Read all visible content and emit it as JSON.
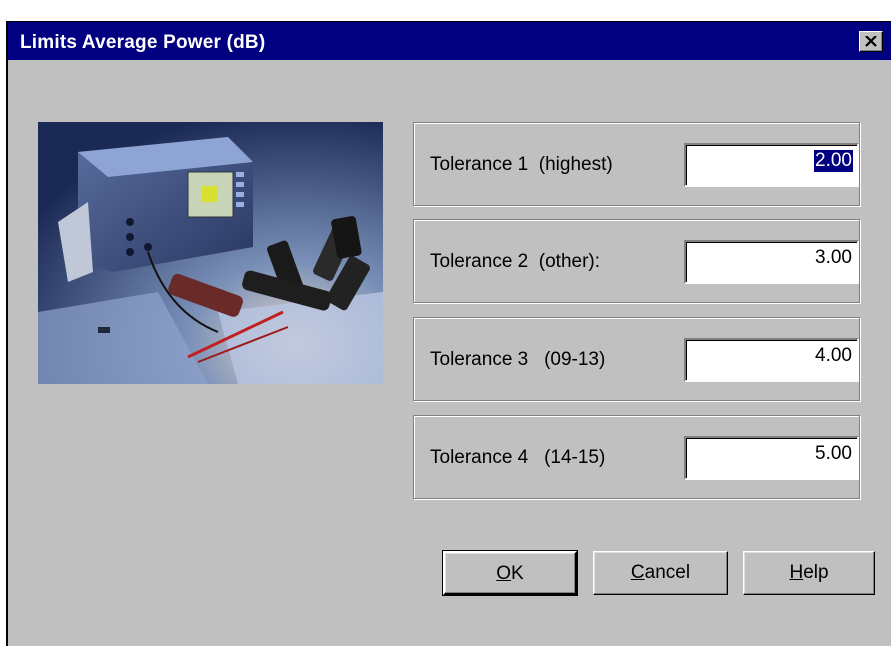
{
  "window": {
    "title": "Limits Average Power (dB)",
    "close_icon": "close-icon"
  },
  "photo": {
    "description_icon": "product-photo"
  },
  "tolerances": [
    {
      "label": "Tolerance 1  (highest)",
      "value": "2.00",
      "selected": true
    },
    {
      "label": "Tolerance 2  (other):",
      "value": "3.00"
    },
    {
      "label": "Tolerance 3   (09-13)",
      "value": "4.00"
    },
    {
      "label": "Tolerance 4   (14-15)",
      "value": "5.00"
    }
  ],
  "buttons": {
    "ok": {
      "mnemonic": "O",
      "rest": "K"
    },
    "cancel": {
      "mnemonic": "C",
      "rest": "ancel"
    },
    "help": {
      "mnemonic": "H",
      "rest": "elp"
    }
  },
  "colors": {
    "titlebar": "#000080",
    "face": "#c0c0c0",
    "selection": "#000080"
  }
}
